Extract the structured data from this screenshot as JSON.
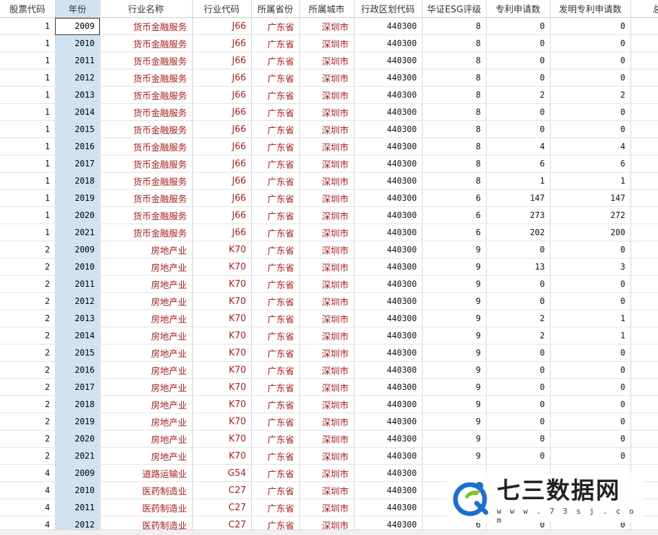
{
  "columns": [
    "股票代码",
    "年份",
    "行业名称",
    "行业代码",
    "所属省份",
    "所属城市",
    "行政区划代码",
    "华证ESG评级",
    "专利申请数",
    "发明专利申请数",
    "总资产"
  ],
  "rows": [
    [
      "1",
      "2009",
      "货币金融服务",
      "J66",
      "广东省",
      "深圳市",
      "440300",
      "8",
      "0",
      "0",
      ""
    ],
    [
      "1",
      "2010",
      "货币金融服务",
      "J66",
      "广东省",
      "深圳市",
      "440300",
      "8",
      "0",
      "0",
      ""
    ],
    [
      "1",
      "2011",
      "货币金融服务",
      "J66",
      "广东省",
      "深圳市",
      "440300",
      "8",
      "0",
      "0",
      ""
    ],
    [
      "1",
      "2012",
      "货币金融服务",
      "J66",
      "广东省",
      "深圳市",
      "440300",
      "8",
      "0",
      "0",
      ""
    ],
    [
      "1",
      "2013",
      "货币金融服务",
      "J66",
      "广东省",
      "深圳市",
      "440300",
      "8",
      "2",
      "2",
      ""
    ],
    [
      "1",
      "2014",
      "货币金融服务",
      "J66",
      "广东省",
      "深圳市",
      "440300",
      "8",
      "0",
      "0",
      ""
    ],
    [
      "1",
      "2015",
      "货币金融服务",
      "J66",
      "广东省",
      "深圳市",
      "440300",
      "8",
      "0",
      "0",
      ""
    ],
    [
      "1",
      "2016",
      "货币金融服务",
      "J66",
      "广东省",
      "深圳市",
      "440300",
      "8",
      "4",
      "4",
      ""
    ],
    [
      "1",
      "2017",
      "货币金融服务",
      "J66",
      "广东省",
      "深圳市",
      "440300",
      "8",
      "6",
      "6",
      ""
    ],
    [
      "1",
      "2018",
      "货币金融服务",
      "J66",
      "广东省",
      "深圳市",
      "440300",
      "8",
      "1",
      "1",
      ""
    ],
    [
      "1",
      "2019",
      "货币金融服务",
      "J66",
      "广东省",
      "深圳市",
      "440300",
      "6",
      "147",
      "147",
      ""
    ],
    [
      "1",
      "2020",
      "货币金融服务",
      "J66",
      "广东省",
      "深圳市",
      "440300",
      "6",
      "273",
      "272",
      ""
    ],
    [
      "1",
      "2021",
      "货币金融服务",
      "J66",
      "广东省",
      "深圳市",
      "440300",
      "6",
      "202",
      "200",
      ""
    ],
    [
      "2",
      "2009",
      "房地产业",
      "K70",
      "广东省",
      "深圳市",
      "440300",
      "9",
      "0",
      "0",
      ""
    ],
    [
      "2",
      "2010",
      "房地产业",
      "K70",
      "广东省",
      "深圳市",
      "440300",
      "9",
      "13",
      "3",
      ""
    ],
    [
      "2",
      "2011",
      "房地产业",
      "K70",
      "广东省",
      "深圳市",
      "440300",
      "9",
      "0",
      "0",
      ""
    ],
    [
      "2",
      "2012",
      "房地产业",
      "K70",
      "广东省",
      "深圳市",
      "440300",
      "9",
      "0",
      "0",
      ""
    ],
    [
      "2",
      "2013",
      "房地产业",
      "K70",
      "广东省",
      "深圳市",
      "440300",
      "9",
      "2",
      "1",
      ""
    ],
    [
      "2",
      "2014",
      "房地产业",
      "K70",
      "广东省",
      "深圳市",
      "440300",
      "9",
      "2",
      "1",
      ""
    ],
    [
      "2",
      "2015",
      "房地产业",
      "K70",
      "广东省",
      "深圳市",
      "440300",
      "9",
      "0",
      "0",
      ""
    ],
    [
      "2",
      "2016",
      "房地产业",
      "K70",
      "广东省",
      "深圳市",
      "440300",
      "9",
      "0",
      "0",
      ""
    ],
    [
      "2",
      "2017",
      "房地产业",
      "K70",
      "广东省",
      "深圳市",
      "440300",
      "9",
      "0",
      "0",
      ""
    ],
    [
      "2",
      "2018",
      "房地产业",
      "K70",
      "广东省",
      "深圳市",
      "440300",
      "9",
      "0",
      "0",
      ""
    ],
    [
      "2",
      "2019",
      "房地产业",
      "K70",
      "广东省",
      "深圳市",
      "440300",
      "9",
      "0",
      "0",
      ""
    ],
    [
      "2",
      "2020",
      "房地产业",
      "K70",
      "广东省",
      "深圳市",
      "440300",
      "9",
      "0",
      "0",
      ""
    ],
    [
      "2",
      "2021",
      "房地产业",
      "K70",
      "广东省",
      "深圳市",
      "440300",
      "9",
      "0",
      "0",
      ""
    ],
    [
      "4",
      "2009",
      "道路运输业",
      "G54",
      "广东省",
      "深圳市",
      "440300",
      "",
      "",
      "",
      ""
    ],
    [
      "4",
      "2010",
      "医药制造业",
      "C27",
      "广东省",
      "深圳市",
      "440300",
      "",
      "",
      "",
      ""
    ],
    [
      "4",
      "2011",
      "医药制造业",
      "C27",
      "广东省",
      "深圳市",
      "440300",
      "",
      "",
      "",
      ""
    ],
    [
      "4",
      "2012",
      "医药制造业",
      "C27",
      "广东省",
      "深圳市",
      "440300",
      "6",
      "0",
      "0",
      ""
    ]
  ],
  "watermark": {
    "title": "七三数据网",
    "url": "w w w . 7 3 s j . c o m",
    "logo_icon": "dragon-logo-icon"
  }
}
